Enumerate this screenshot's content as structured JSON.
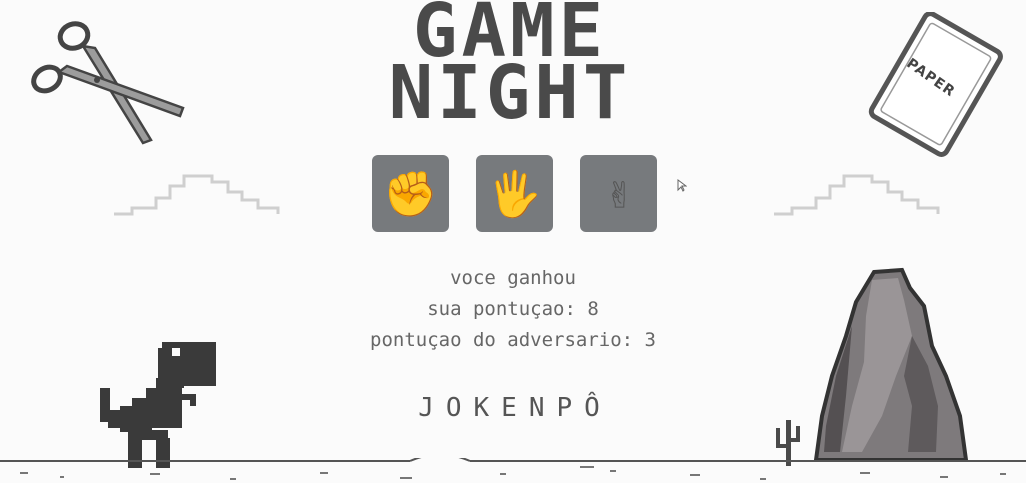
{
  "title": {
    "line1": "GAME",
    "line2": "NIGHT"
  },
  "choices": [
    {
      "icon": "fist-emoji",
      "glyph": "✊"
    },
    {
      "icon": "open-hand-emoji",
      "glyph": "🖐"
    },
    {
      "icon": "victory-hand-emoji",
      "glyph": "✌"
    }
  ],
  "status": {
    "result": "voce ganhou",
    "player_score": "sua pontuçao: 8",
    "opponent_score": "pontuçao do adversario: 3"
  },
  "subtitle": "JOKENPÔ",
  "paper_card": {
    "label": "PAPER"
  },
  "colors": {
    "button": "#777a7d",
    "text": "#666666",
    "title": "#4a4a4a"
  }
}
